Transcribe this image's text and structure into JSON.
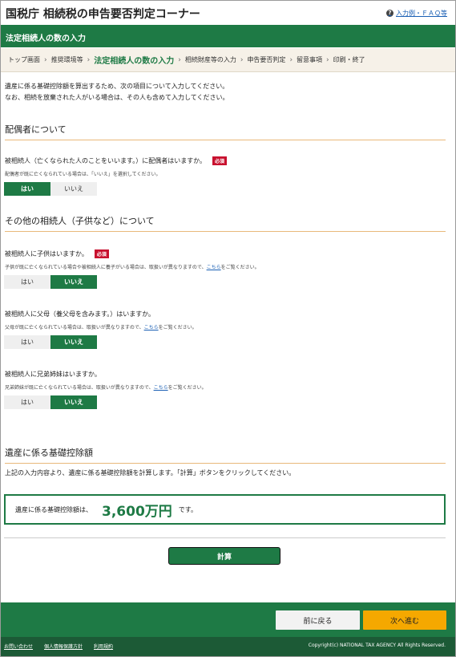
{
  "header": {
    "site_title": "国税庁 相続税の申告要否判定コーナー",
    "faq_link": "入力例・ＦＡＱ等",
    "help_glyph": "?"
  },
  "page_title": "法定相続人の数の入力",
  "breadcrumb": {
    "items": [
      "トップ画面",
      "推奨環境等",
      "法定相続人の数の入力",
      "相続財産等の入力",
      "申告要否判定",
      "留意事項",
      "印刷・終了"
    ],
    "separator": "›"
  },
  "intro": {
    "line1": "遺産に係る基礎控除額を算出するため、次の項目について入力してください。",
    "line2": "なお、相続を放棄された人がいる場合は、その人も含めて入力してください。"
  },
  "spouse_section": {
    "heading": "配偶者について",
    "question": "被相続人（亡くなられた人のことをいいます。）に配偶者はいますか。",
    "required": "必須",
    "note": "配偶者が既に亡くなられている場合は、「いいえ」を選択してください。",
    "yes": "はい",
    "no": "いいえ",
    "selected": "yes"
  },
  "other_section": {
    "heading": "その他の相続人（子供など）について",
    "children": {
      "question": "被相続人に子供はいますか。",
      "required": "必須",
      "note_before": "子供が既に亡くなられている場合や被相続人に養子がいる場合は、取扱いが異なりますので、",
      "note_link": "こちら",
      "note_after": "をご覧ください。",
      "yes": "はい",
      "no": "いいえ",
      "selected": "no"
    },
    "parents": {
      "question": "被相続人に父母（養父母を含みます。）はいますか。",
      "note_before": "父母が既に亡くなられている場合は、取扱いが異なりますので、",
      "note_link": "こちら",
      "note_after": "をご覧ください。",
      "yes": "はい",
      "no": "いいえ",
      "selected": "no"
    },
    "siblings": {
      "question": "被相続人に兄弟姉妹はいますか。",
      "note_before": "兄弟姉妹が既に亡くなられている場合は、取扱いが異なりますので、",
      "note_link": "こちら",
      "note_after": "をご覧ください。",
      "yes": "はい",
      "no": "いいえ",
      "selected": "no"
    }
  },
  "deduction_section": {
    "heading": "遺産に係る基礎控除額",
    "description": "上記の入力内容より、遺産に係る基礎控除額を計算します。「計算」ボタンをクリックしてください。",
    "result_label": "遺産に係る基礎控除額は、",
    "result_amount": "3,600万円",
    "result_suffix": "です。",
    "calc_button": "計算"
  },
  "nav": {
    "back": "前に戻る",
    "next": "次へ進む"
  },
  "footer": {
    "links": [
      "お問い合わせ",
      "個人情報保護方針",
      "利用規約"
    ],
    "copyright": "Copyright(c) NATIONAL TAX AGENCY All Rights Reserved."
  },
  "colors": {
    "brand_green": "#1e7a45",
    "next_orange": "#f5a800",
    "required_red": "#c8102e"
  }
}
